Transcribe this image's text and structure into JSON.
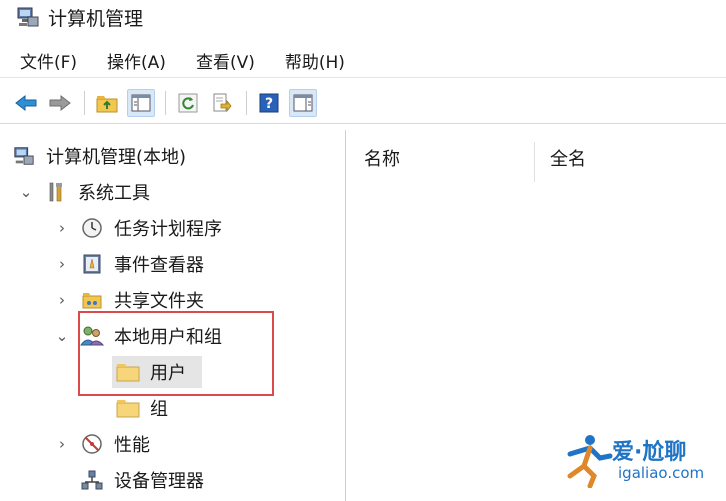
{
  "window": {
    "title": "计算机管理"
  },
  "menu": [
    "文件(F)",
    "操作(A)",
    "查看(V)",
    "帮助(H)"
  ],
  "toolbar": {
    "buttons": [
      "back-icon",
      "forward-icon",
      "up-folder-icon",
      "show-tree-icon",
      "refresh-icon",
      "export-icon",
      "help-icon",
      "properties-icon"
    ]
  },
  "tree": {
    "root": "计算机管理(本地)",
    "system_tools": "系统工具",
    "task_scheduler": "任务计划程序",
    "event_viewer": "事件查看器",
    "shared_folders": "共享文件夹",
    "local_users_groups": "本地用户和组",
    "users": "用户",
    "groups": "组",
    "performance": "性能",
    "device_manager": "设备管理器"
  },
  "list": {
    "columns": [
      "名称",
      "全名"
    ]
  },
  "watermark": {
    "line1": "爱·尬聊",
    "line2": "igaliao.com"
  }
}
